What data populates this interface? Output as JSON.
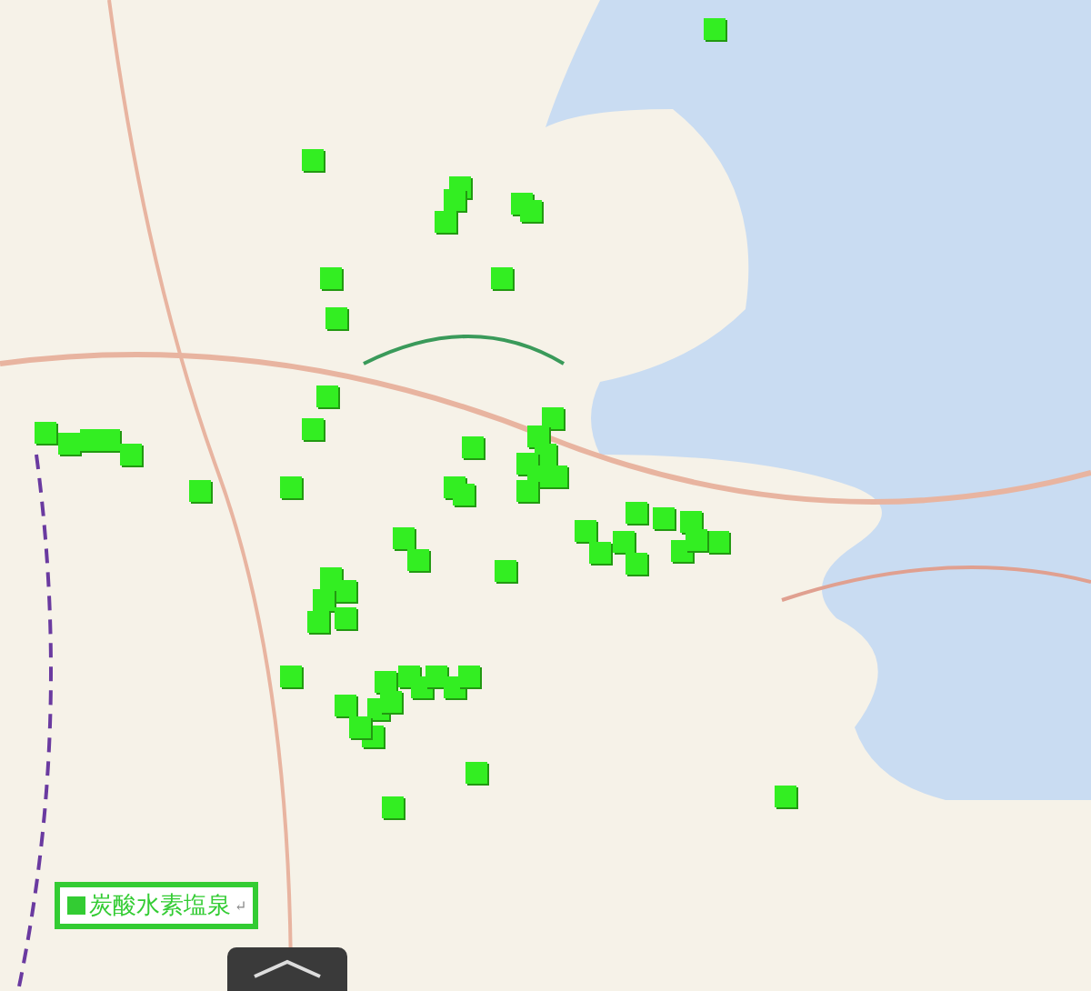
{
  "legend": {
    "label": "炭酸水素塩泉",
    "return_mark": "↵",
    "color": "#33cc33"
  },
  "markers": {
    "color": "#33ee22"
  }
}
